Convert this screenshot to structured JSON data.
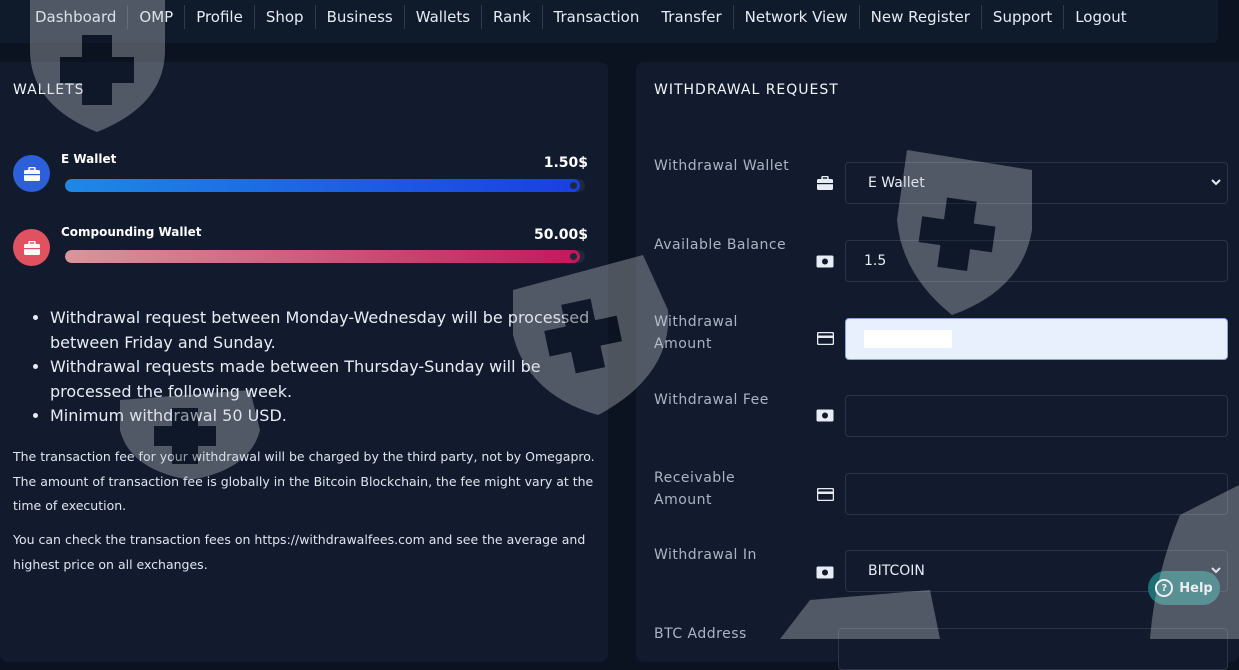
{
  "nav": {
    "items": [
      "Dashboard",
      "OMP",
      "Profile",
      "Shop",
      "Business",
      "Wallets",
      "Rank",
      "Transaction",
      "Transfer",
      "Network View",
      "New Register",
      "Support",
      "Logout"
    ]
  },
  "wallets": {
    "title": "WALLETS",
    "items": [
      {
        "name": "E Wallet",
        "amount": "1.50$",
        "fill": 0.99,
        "color_start": "#1e88e5",
        "color_end": "#1a3fe0",
        "icon_bg": "#2d5fd8"
      },
      {
        "name": "Compounding Wallet",
        "amount": "50.00$",
        "fill": 0.99,
        "color_start": "#d9969a",
        "color_end": "#c2185b",
        "icon_bg": "#e05260"
      }
    ],
    "rules": [
      "Withdrawal request between Monday-Wednesday will be processed between Friday and Sunday.",
      "Withdrawal requests made between Thursday-Sunday will be processed the following week.",
      "Minimum withdrawal 50 USD."
    ],
    "fee_note": "The transaction fee for your withdrawal will be charged by the third party, not by Omegapro. The amount of transaction fee is globally in the Bitcoin Blockchain, the fee might vary at the time of execution.",
    "fee_check": "You can check the transaction fees on https://withdrawalfees.com and see the average and highest price on all exchanges."
  },
  "withdrawal": {
    "title": "WITHDRAWAL REQUEST",
    "wallet_label": "Withdrawal Wallet",
    "wallet_value": "E Wallet",
    "balance_label": "Available Balance",
    "balance_value": "1.5",
    "amount_label": "Withdrawal Amount",
    "amount_value": "",
    "fee_label": "Withdrawal Fee",
    "fee_value": "",
    "receivable_label": "Receivable Amount",
    "receivable_value": "",
    "in_label": "Withdrawal In",
    "in_value": "BITCOIN",
    "btc_label": "BTC Address"
  },
  "help": {
    "label": "Help"
  }
}
